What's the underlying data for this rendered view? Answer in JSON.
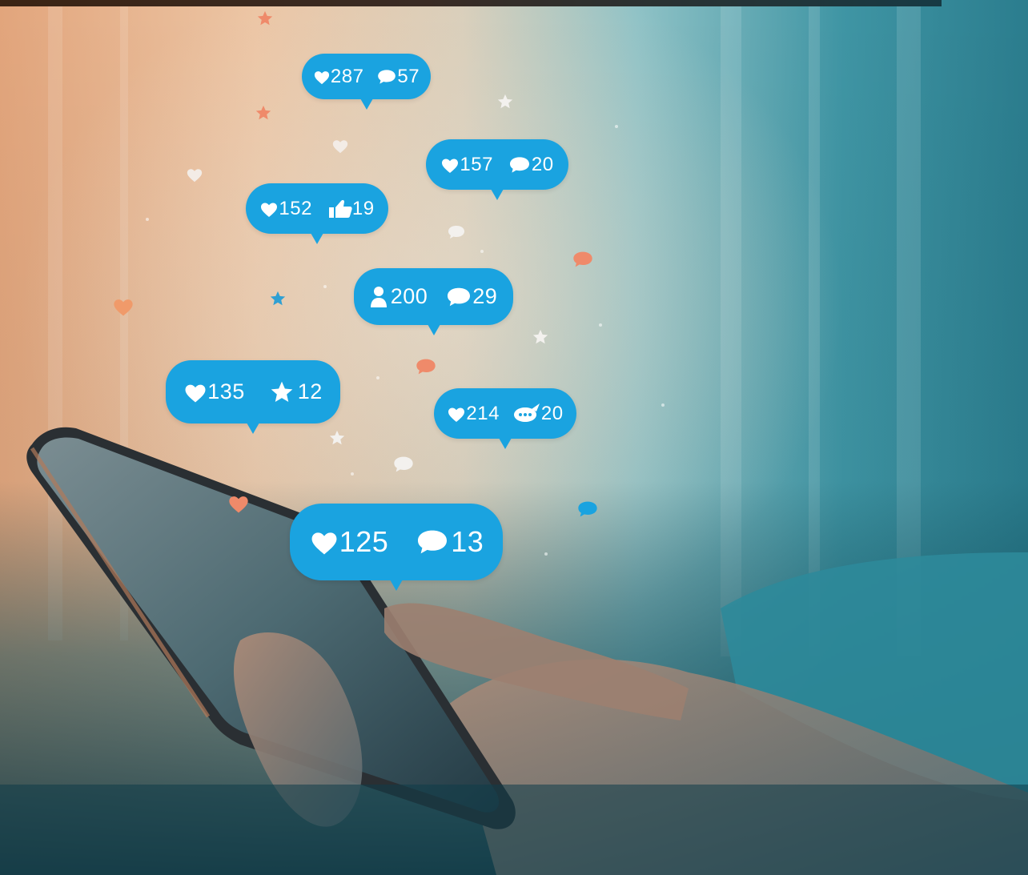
{
  "notifications": [
    {
      "likes": "287",
      "comments": "57"
    },
    {
      "likes": "157",
      "comments": "20"
    },
    {
      "likes": "152",
      "thumbs_up": "19"
    },
    {
      "followers": "200",
      "comments": "29"
    },
    {
      "likes": "135",
      "stars": "12"
    },
    {
      "likes": "214",
      "replies": "20"
    },
    {
      "likes": "125",
      "comments": "13"
    }
  ],
  "colors": {
    "bubble": "#1aa3e0",
    "warm_bg": "#e9b98f",
    "cool_bg": "#2c7e8e",
    "coral_icon": "#ef8a6a"
  },
  "icons": [
    "heart-icon",
    "comment-icon",
    "thumbs-up-icon",
    "user-icon",
    "star-icon",
    "chat-dots-icon"
  ]
}
